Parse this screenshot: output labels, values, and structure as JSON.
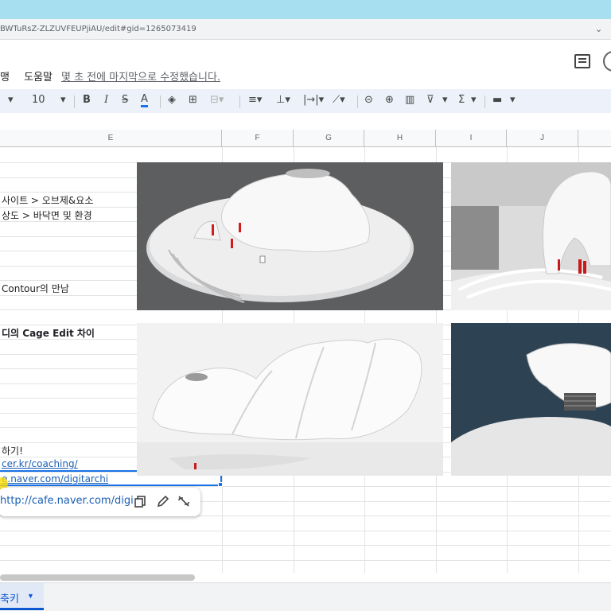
{
  "browser": {
    "url": "BWTuRsZ-ZLZUVFEUPjiAU/edit#gid=1265073419"
  },
  "menu": {
    "items": [
      "맹",
      "도움말"
    ],
    "last_edit": "몇 초 전에 마지막으로 수정했습니다."
  },
  "toolbar": {
    "font_size": "10",
    "bold": "B",
    "italic": "I",
    "strike": "S",
    "text_color": "A",
    "functions": "Σ"
  },
  "columns": [
    "E",
    "F",
    "G",
    "H",
    "I",
    "J"
  ],
  "cells": {
    "r1": "사이트 > 오브제&요소",
    "r2": "상도 > 바닥면 및 환경",
    "r3": "Contour의 만남",
    "r4": "디의 Cage Edit 차이",
    "r5": "하기!",
    "r6": "cer.kr/coaching/",
    "r7": "e.naver.com/digitarchi"
  },
  "link_chip": {
    "text": "http://cafe.naver.com/digi..."
  },
  "sheet_tab": {
    "label": "축키"
  },
  "colors": {
    "accent": "#1a73e8",
    "link": "#1a5fb4",
    "toolbar_bg": "#edf2fa"
  }
}
